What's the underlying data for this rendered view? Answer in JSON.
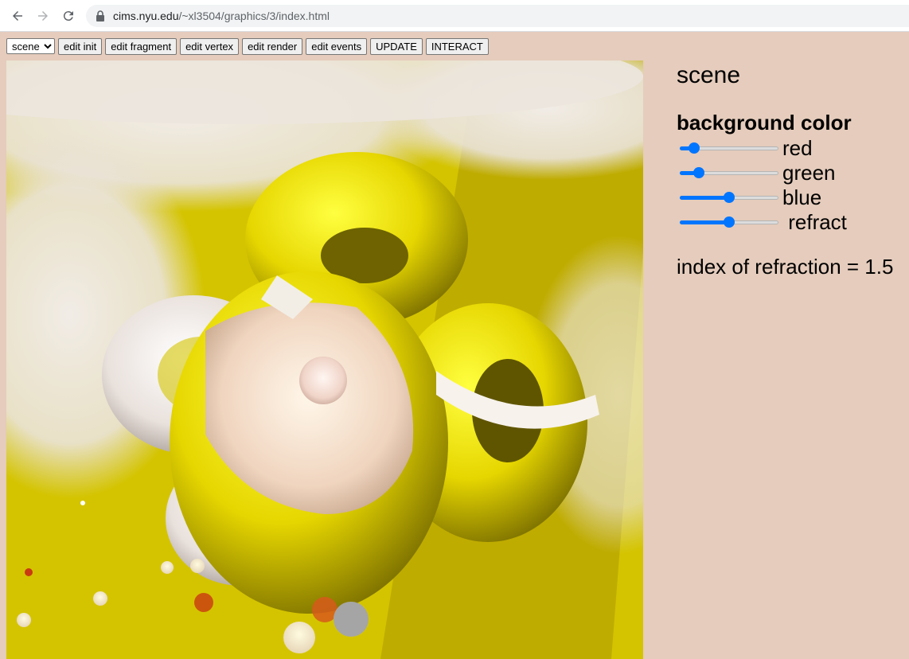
{
  "browser": {
    "url_host": "cims.nyu.edu",
    "url_path": "/~xl3504/graphics/3/index.html"
  },
  "toolbar": {
    "scene_select": "scene",
    "buttons": [
      "edit init",
      "edit fragment",
      "edit vertex",
      "edit render",
      "edit events",
      "UPDATE",
      "INTERACT"
    ]
  },
  "panel": {
    "title": "scene",
    "section_title": "background color",
    "sliders": [
      {
        "label": "red",
        "value": 0.1
      },
      {
        "label": "green",
        "value": 0.15
      },
      {
        "label": "blue",
        "value": 0.5
      },
      {
        "label": " refract",
        "value": 0.5
      }
    ],
    "refraction_text": "index of refraction = 1.5"
  },
  "colors": {
    "page_background": "#e5ccbc",
    "scene_background": "#d4c400",
    "torus_yellow": "#f2e200",
    "torus_white": "#f4ece8",
    "slider_accent": "#0075ff"
  }
}
